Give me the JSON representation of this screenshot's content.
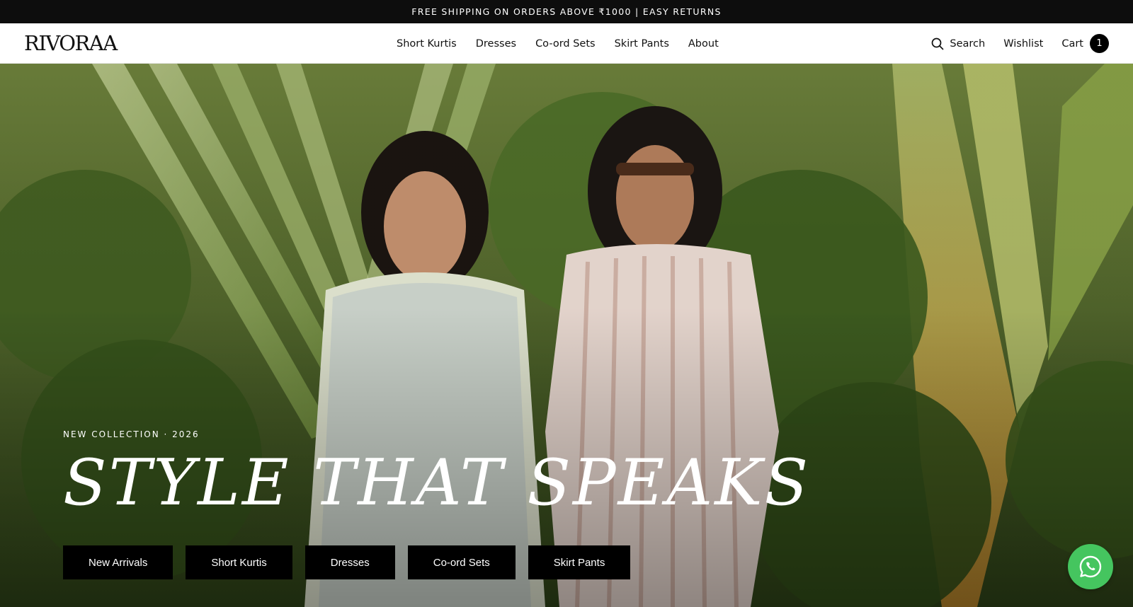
{
  "announcement": {
    "text": "FREE SHIPPING ON ORDERS ABOVE ₹1000 | EASY RETURNS"
  },
  "header": {
    "logo": "RIVORAA",
    "nav": [
      {
        "label": "Short Kurtis"
      },
      {
        "label": "Dresses"
      },
      {
        "label": "Co-ord Sets"
      },
      {
        "label": "Skirt Pants"
      },
      {
        "label": "About"
      }
    ],
    "utility": {
      "search_label": "Search",
      "search_icon": "search-icon",
      "wishlist_label": "Wishlist",
      "cart_label": "Cart",
      "cart_count": "1"
    }
  },
  "hero": {
    "eyebrow": "NEW COLLECTION · 2026",
    "headline": "STYLE THAT SPEAKS",
    "ctas": [
      {
        "label": "New Arrivals"
      },
      {
        "label": "Short Kurtis"
      },
      {
        "label": "Dresses"
      },
      {
        "label": "Co-ord Sets"
      },
      {
        "label": "Skirt Pants"
      }
    ]
  },
  "floating": {
    "whatsapp_icon": "whatsapp-icon"
  },
  "colors": {
    "announcement_bg": "#0d0d0d",
    "button_bg": "#000000",
    "whatsapp_green": "#45c55f"
  }
}
